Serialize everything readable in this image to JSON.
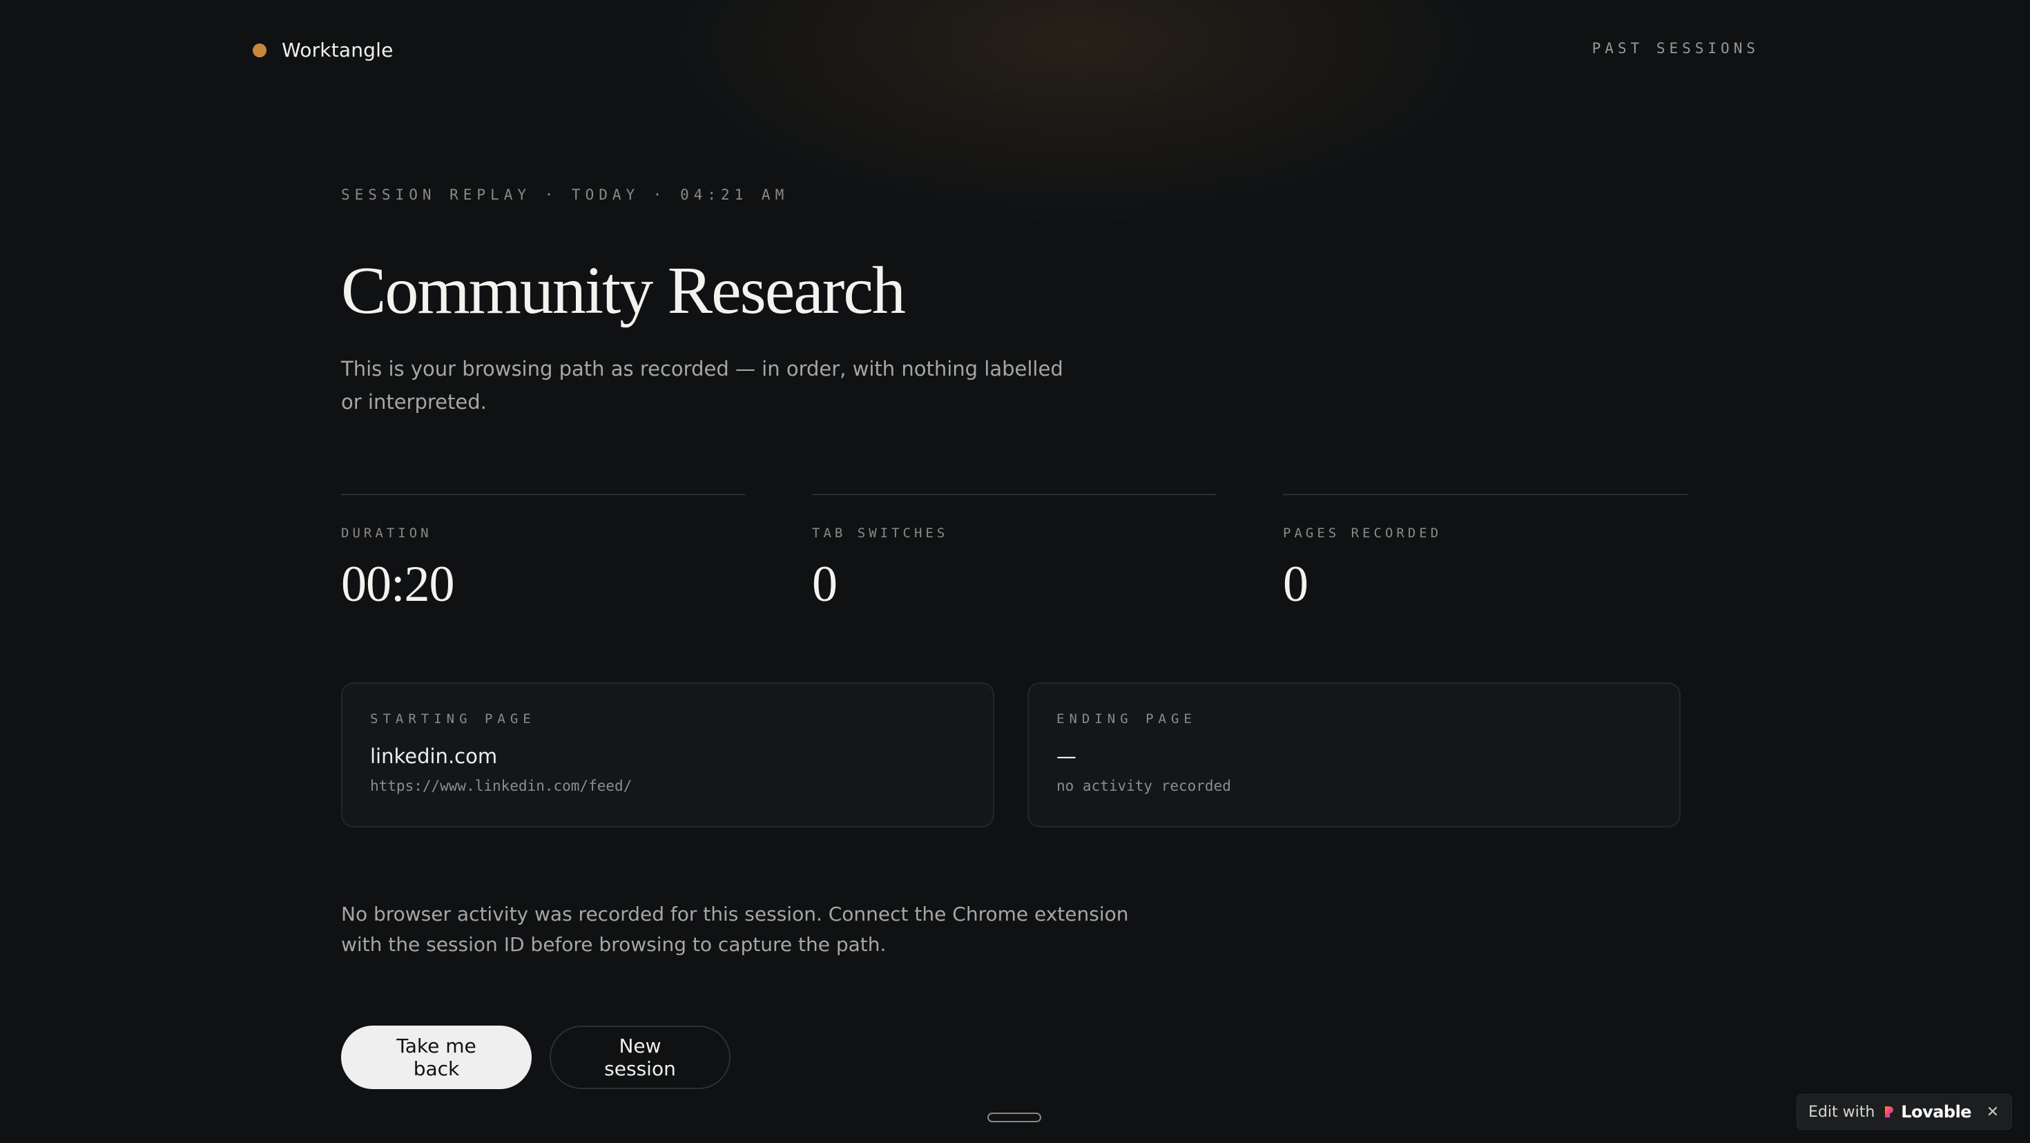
{
  "header": {
    "brand": "Worktangle",
    "nav_past_sessions": "PAST SESSIONS"
  },
  "hero": {
    "eyebrow": "SESSION REPLAY · TODAY · 04:21 AM",
    "title": "Community Research",
    "intro": "This is your browsing path as recorded — in order, with nothing labelled or interpreted."
  },
  "stats": [
    {
      "label": "DURATION",
      "value": "00:20"
    },
    {
      "label": "TAB SWITCHES",
      "value": "0"
    },
    {
      "label": "PAGES RECORDED",
      "value": "0"
    }
  ],
  "cards": {
    "start": {
      "label": "STARTING PAGE",
      "domain": "linkedin.com",
      "url": "https://www.linkedin.com/feed/"
    },
    "end": {
      "label": "ENDING PAGE",
      "domain": "—",
      "url": "no activity recorded"
    }
  },
  "note": "No browser activity was recorded for this session. Connect the Chrome extension with the session ID before browsing to capture the path.",
  "actions": {
    "back_label": "Take me back",
    "new_label": "New session"
  },
  "badge": {
    "edit_label": "Edit with",
    "brand": "Lovable",
    "close_glyph": "✕"
  },
  "colors": {
    "accent": "#c8873e",
    "background": "#0f1113",
    "card_bg": "#14171a",
    "primary_button_bg": "#efefef"
  },
  "icons": {
    "brand_dot": "circle-dot-icon",
    "lovable_logo": "heart-logo-icon",
    "close": "close-icon"
  }
}
